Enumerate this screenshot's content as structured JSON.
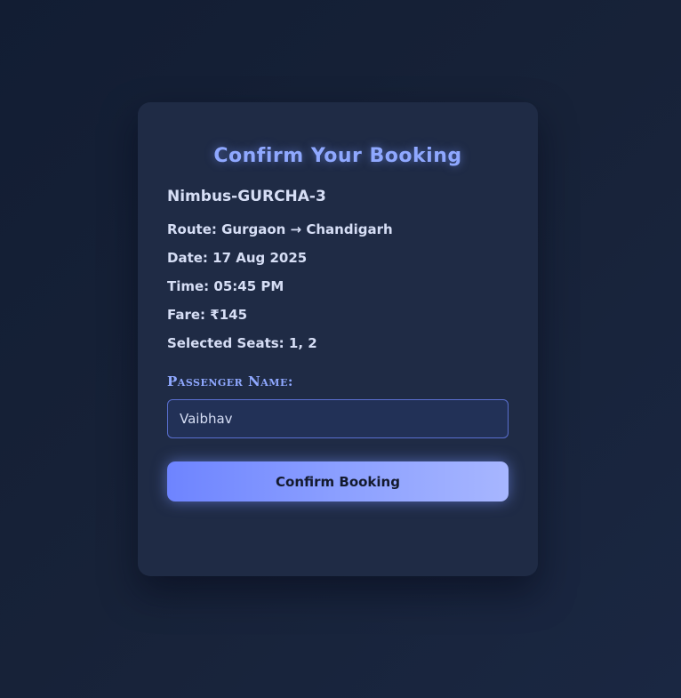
{
  "card": {
    "title": "Confirm Your Booking",
    "bus_name": "Nimbus-GURCHA-3",
    "details": {
      "route": "Route: Gurgaon → Chandigarh",
      "date": "Date: 17 Aug 2025",
      "time": "Time: 05:45 PM",
      "fare": "Fare: ₹145",
      "seats": "Selected Seats: 1, 2"
    },
    "passenger": {
      "label": "Passenger Name:",
      "value": "Vaibhav"
    },
    "confirm_label": "Confirm Booking"
  },
  "colors": {
    "accent": "#8fa8ff",
    "card_bg": "#1f2b45",
    "page_bg": "#172238",
    "button_gradient_start": "#6e84ff",
    "button_gradient_end": "#a7b6ff"
  }
}
